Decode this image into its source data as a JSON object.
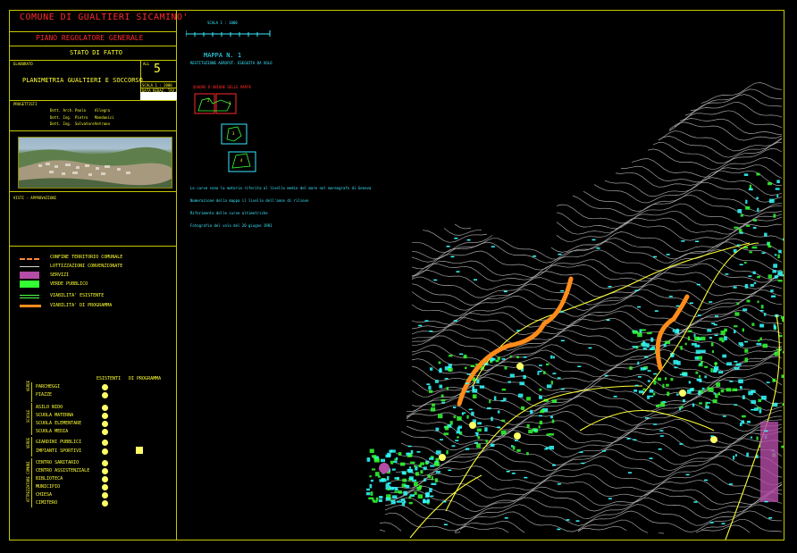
{
  "title_block": {
    "comune": "COMUNE  DI  GUALTIERI SICAMINO'",
    "piano": "PIANO  REGOLATORE  GENERALE",
    "stato": "STATO DI FATTO",
    "elaborato_label": "ELABORATO",
    "all_label": "ALL",
    "all_number": "5",
    "tavola": "PLANIMETRIA GUALTIERI E SOCCORSO",
    "scala": "SCALA  1 : 2000",
    "data": "DATA  REDAZ. TAV.",
    "progettisti_label": "PROGETTISTI",
    "progettisti": [
      {
        "title": "Dott. Arch.",
        "first": "Paolo",
        "last": "Allegra"
      },
      {
        "title": "Dott. Ing.",
        "first": "Pietro",
        "last": "Mandanici"
      },
      {
        "title": "Dott. Ing.",
        "first": "Salvatore",
        "last": "Vetrano"
      }
    ],
    "visti_label": "VISTI - APPROVAZIONI"
  },
  "legend": {
    "items": [
      {
        "label": "CONFINE TERRITORIO COMUNALE",
        "style": "dashed",
        "color": "#ff8a3a"
      },
      {
        "label": "LOTTIZZAZIONI CONVENZIONATE",
        "style": "line",
        "color": "#d8d8d8"
      },
      {
        "label": "SERVIZI",
        "style": "fill",
        "color": "#b54ca6"
      },
      {
        "label": "VERDE PUBBLICO",
        "style": "fill",
        "color": "#33ff33"
      },
      {
        "label": "VIABILITA' ESISTENTE",
        "style": "line",
        "color": "#4cff4c"
      },
      {
        "label": "VIABILITA' DI PROGRAMMA",
        "style": "thick",
        "color": "#ff8c1a"
      }
    ]
  },
  "services_table": {
    "col_existing": "ESISTENTI",
    "col_program": "DI PROGRAMMA",
    "groups": [
      {
        "group": "VERDE",
        "rows": [
          {
            "label": "PARCHEGGI",
            "existing": true,
            "program": false
          },
          {
            "label": "PIAZZE",
            "existing": true,
            "program": false
          }
        ]
      },
      {
        "group": "SCUOLE",
        "rows": [
          {
            "label": "ASILO NIDO",
            "existing": true,
            "program": false
          },
          {
            "label": "SCUOLA MATERNA",
            "existing": true,
            "program": false
          },
          {
            "label": "SCUOLA ELEMENTARE",
            "existing": true,
            "program": false
          },
          {
            "label": "SCUOLA MEDIA",
            "existing": true,
            "program": false
          }
        ]
      },
      {
        "group": "VERDE",
        "rows": [
          {
            "label": "GIARDINI PUBBLICI",
            "existing": true,
            "program": false
          },
          {
            "label": "IMPIANTI SPORTIVI",
            "existing": true,
            "program": true
          }
        ]
      },
      {
        "group": "ATTREZZATURE COMUNI",
        "rows": [
          {
            "label": "CENTRO SANITARIO",
            "existing": true,
            "program": false
          },
          {
            "label": "CENTRO ASSISTENZIALE",
            "existing": true,
            "program": false
          },
          {
            "label": "BIBLIOTECA",
            "existing": true,
            "program": false
          },
          {
            "label": "MUNICIPIO",
            "existing": true,
            "program": false
          },
          {
            "label": "CHIESA",
            "existing": true,
            "program": false
          },
          {
            "label": "CIMITERO",
            "existing": true,
            "program": false
          }
        ]
      }
    ]
  },
  "map_info": {
    "scale_bar_label": "SCALA  1 : 1000",
    "mappa_title": "MAPPA N. 1",
    "mappa_note": "RESTITUZIONE AEROFOT. ESEGUITA DA VOLO",
    "quadro_label": "QUADRO D'UNIONE DELLE MAPPE",
    "key_maps": [
      "1",
      "2",
      "3",
      "4"
    ],
    "notes": [
      "Le curve sono la materia riferita al livello medio del mare nel mareografo di Genova",
      "Numerazione della mappa il livello dell'anno di rilievo",
      "Riferimento delle curve altimetriche"
    ],
    "footer_note": "Fotografia del volo del 20 giugno 1981"
  },
  "colors": {
    "frame": "#c8c800",
    "contours": "#bdbdbd",
    "roads": "#ffff33",
    "buildings": "#33ffff",
    "green": "#33ff33",
    "orange": "#ff8c1a",
    "services": "#b54ca6"
  }
}
